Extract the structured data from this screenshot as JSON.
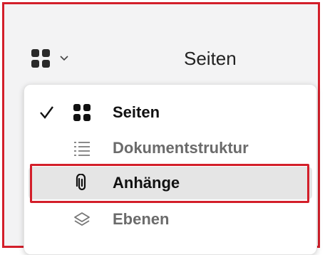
{
  "header": {
    "title": "Seiten",
    "view_icon": "grid-view-icon",
    "dropdown_icon": "chevron-down-icon"
  },
  "menu": {
    "items": [
      {
        "label": "Seiten",
        "icon": "grid-view-icon",
        "checked": true
      },
      {
        "label": "Dokumentstruktur",
        "icon": "list-icon",
        "checked": false
      },
      {
        "label": "Anhänge",
        "icon": "paperclip-icon",
        "checked": false,
        "highlighted": true
      },
      {
        "label": "Ebenen",
        "icon": "layers-icon",
        "checked": false
      }
    ]
  },
  "colors": {
    "annotation_red": "#d31f2a",
    "highlight_bg": "#e5e5e5",
    "panel_bg": "#f3f3f4"
  }
}
